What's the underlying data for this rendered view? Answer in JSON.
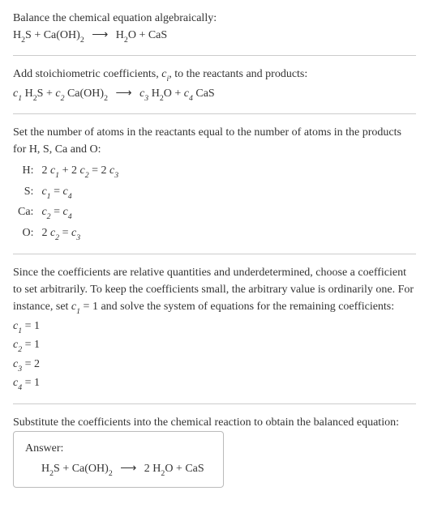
{
  "s1": {
    "intro": "Balance the chemical equation algebraically:",
    "lhs1": "H",
    "lhs1s": "2",
    "lhs1b": "S + Ca(OH)",
    "lhs1s2": "2",
    "arrow": "⟶",
    "rhs1": "H",
    "rhs1s": "2",
    "rhs1b": "O + CaS"
  },
  "s2": {
    "intro_a": "Add stoichiometric coefficients, ",
    "ci_c": "c",
    "ci_i": "i",
    "intro_b": ", to the reactants and products:",
    "c1": "c",
    "c1s": "1",
    "sp1": " H",
    "sp1s": "2",
    "sp1b": "S + ",
    "c2": "c",
    "c2s": "2",
    "sp2": " Ca(OH)",
    "sp2s": "2",
    "arrow": "⟶",
    "c3": "c",
    "c3s": "3",
    "sp3": " H",
    "sp3s": "2",
    "sp3b": "O + ",
    "c4": "c",
    "c4s": "4",
    "sp4": " CaS"
  },
  "s3": {
    "intro": "Set the number of atoms in the reactants equal to the number of atoms in the products for H, S, Ca and O:",
    "rows": [
      {
        "el": "H:",
        "eq_a": "2 ",
        "c1": "c",
        "c1s": "1",
        "mid": " + 2 ",
        "c2": "c",
        "c2s": "2",
        "eqs": " = 2 ",
        "c3": "c",
        "c3s": "3"
      },
      {
        "el": "S:",
        "c1": "c",
        "c1s": "1",
        "eqs": " = ",
        "c4": "c",
        "c4s": "4"
      },
      {
        "el": "Ca:",
        "c2": "c",
        "c2s": "2",
        "eqs": " = ",
        "c4": "c",
        "c4s": "4"
      },
      {
        "el": "O:",
        "eq_a": "2 ",
        "c2": "c",
        "c2s": "2",
        "eqs": " = ",
        "c3": "c",
        "c3s": "3"
      }
    ]
  },
  "s4": {
    "intro_a": "Since the coefficients are relative quantities and underdetermined, choose a coefficient to set arbitrarily. To keep the coefficients small, the arbitrary value is ordinarily one. For instance, set ",
    "c1": "c",
    "c1s": "1",
    "eq": " = 1",
    "intro_b": " and solve the system of equations for the remaining coefficients:",
    "sol": [
      {
        "c": "c",
        "s": "1",
        "v": " = 1"
      },
      {
        "c": "c",
        "s": "2",
        "v": " = 1"
      },
      {
        "c": "c",
        "s": "3",
        "v": " = 2"
      },
      {
        "c": "c",
        "s": "4",
        "v": " = 1"
      }
    ]
  },
  "s5": {
    "intro": "Substitute the coefficients into the chemical reaction to obtain the balanced equation:",
    "answer_label": "Answer:",
    "lhs1": "H",
    "lhs1s": "2",
    "lhs1b": "S + Ca(OH)",
    "lhs1s2": "2",
    "arrow": "⟶",
    "rhs_pre": "2 H",
    "rhs1s": "2",
    "rhs1b": "O + CaS"
  }
}
